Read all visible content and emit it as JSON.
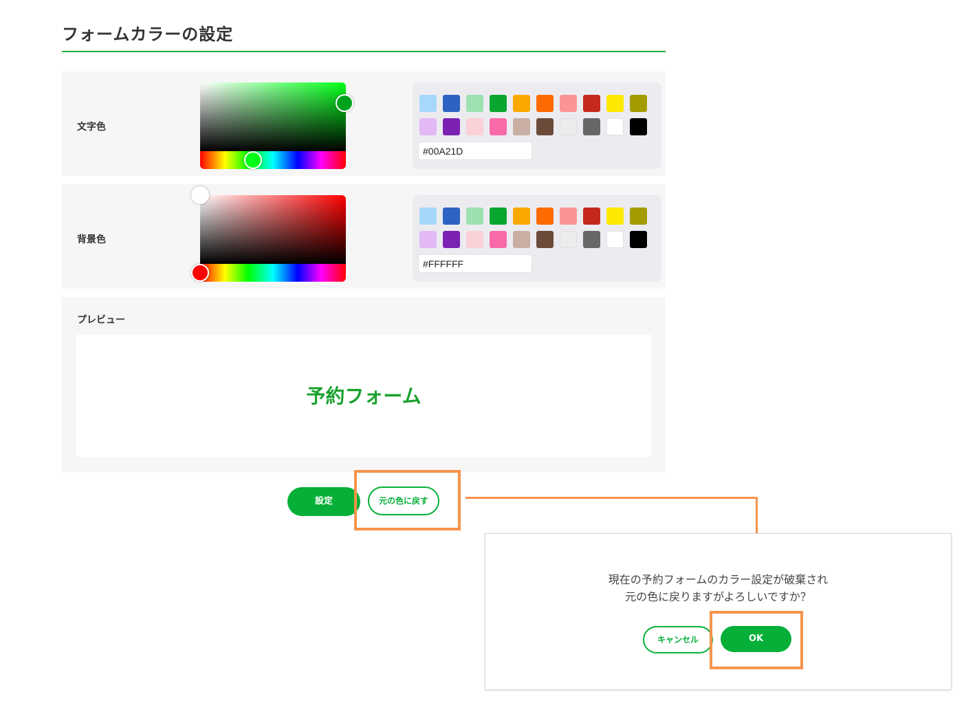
{
  "page": {
    "title": "フォームカラーの設定"
  },
  "text_color": {
    "label": "文字色",
    "hex_value": "#00A21D",
    "hue_color": "#00ff18",
    "selected_color": "#00A21D"
  },
  "background_color": {
    "label": "背景色",
    "hex_value": "#FFFFFF",
    "hue_color": "#ff0000",
    "selected_color": "#FFFFFF"
  },
  "palette": [
    "#a6d8fb",
    "#2d62c2",
    "#9ee0b0",
    "#08a62e",
    "#fda800",
    "#fd6a00",
    "#fb9494",
    "#c5281c",
    "#fde800",
    "#a39c00",
    "#e2b8f5",
    "#7b22b5",
    "#fad1d6",
    "#f96aa8",
    "#c9aea3",
    "#6c4a3a",
    "#ececec",
    "#676767",
    "#ffffff",
    "#000000"
  ],
  "preview": {
    "label": "プレビュー",
    "sample_text": "予約フォーム"
  },
  "buttons": {
    "set": "設定",
    "reset": "元の色に戻す"
  },
  "dialog": {
    "message_line1": "現在の予約フォームのカラー設定が破棄され",
    "message_line2": "元の色に戻りますがよろしいですか？",
    "cancel": "キャンセル",
    "ok": "OK"
  },
  "colors": {
    "accent": "#06b038",
    "highlight": "#f7934a",
    "panel_bg": "#f6f6f6"
  }
}
